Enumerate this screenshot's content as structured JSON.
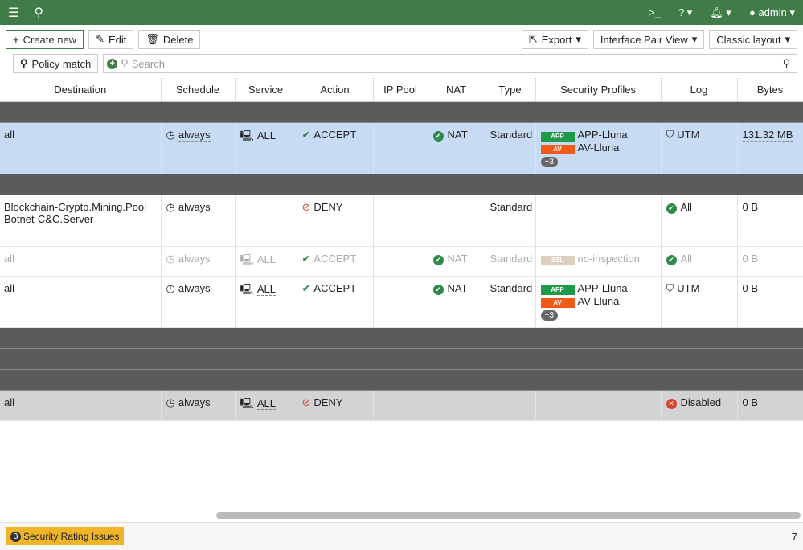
{
  "topbar": {
    "user": "admin"
  },
  "toolbar": {
    "create": "Create new",
    "edit": "Edit",
    "delete": "Delete",
    "export": "Export",
    "interface_pair_view": "Interface Pair View",
    "layout": "Classic layout"
  },
  "search": {
    "policy_match": "Policy match",
    "placeholder": "Search"
  },
  "columns": [
    "Destination",
    "Schedule",
    "Service",
    "Action",
    "IP Pool",
    "NAT",
    "Type",
    "Security Profiles",
    "Log",
    "Bytes"
  ],
  "rows": [
    {
      "kind": "grp"
    },
    {
      "kind": "sel",
      "dest": [
        "all"
      ],
      "schedule": "always",
      "service": "ALL",
      "action": "ACCEPT",
      "nat": "NAT",
      "type": "Standard",
      "profiles": [
        {
          "tag": "APP",
          "name": "APP-Lluna",
          "color": "#1e9a4a"
        },
        {
          "tag": "AV",
          "name": "AV-Lluna",
          "color": "#f25a18"
        }
      ],
      "more": "+3",
      "log": "UTM",
      "bytes": "131.32 MB"
    },
    {
      "kind": "grp"
    },
    {
      "kind": "",
      "dest": [
        "Blockchain-Crypto.Mining.Pool",
        "Botnet-C&C.Server"
      ],
      "schedule": "always",
      "service": "",
      "action": "DENY",
      "nat": "",
      "type": "Standard",
      "profiles": [],
      "log": "All",
      "bytes": "0 B"
    },
    {
      "kind": "dis",
      "dest": [
        "all"
      ],
      "schedule": "always",
      "service": "ALL",
      "action": "ACCEPT",
      "nat": "NAT",
      "type": "Standard",
      "profiles": [
        {
          "tag": "SSL",
          "name": "no-inspection",
          "color": "#dccfbd"
        }
      ],
      "log": "All",
      "bytes": "0 B"
    },
    {
      "kind": "",
      "dest": [
        "all"
      ],
      "schedule": "always",
      "service": "ALL",
      "action": "ACCEPT",
      "nat": "NAT",
      "type": "Standard",
      "profiles": [
        {
          "tag": "APP",
          "name": "APP-Lluna",
          "color": "#1e9a4a"
        },
        {
          "tag": "AV",
          "name": "AV-Lluna",
          "color": "#f25a18"
        }
      ],
      "more": "+3",
      "log": "UTM",
      "bytes": "0 B"
    },
    {
      "kind": "grp"
    },
    {
      "kind": "grp"
    },
    {
      "kind": "grp"
    },
    {
      "kind": "gray",
      "dest": [
        "all"
      ],
      "schedule": "always",
      "service": "ALL",
      "action": "DENY",
      "nat": "",
      "type": "",
      "profiles": [],
      "log": "Disabled",
      "bytes": "0 B"
    }
  ],
  "footer": {
    "security_issues_count": "3",
    "security_issues": "Security Rating Issues",
    "total": "7"
  }
}
